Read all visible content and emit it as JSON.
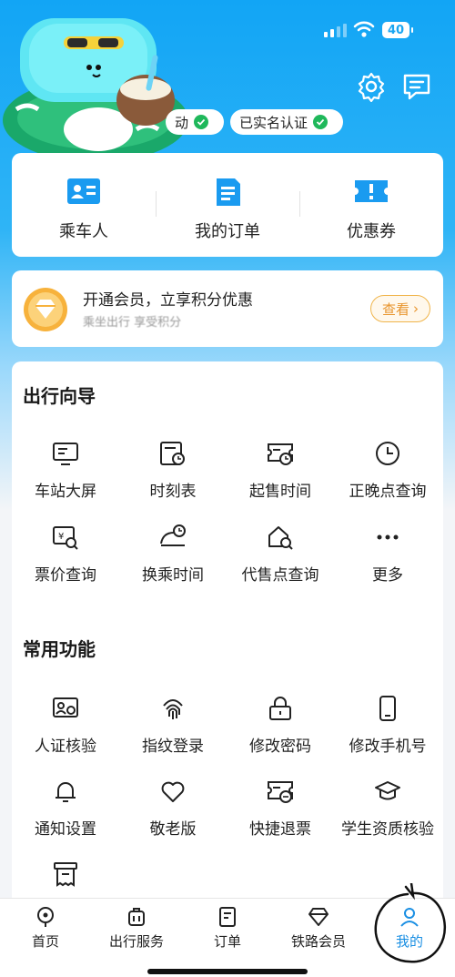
{
  "status_bar": {
    "battery": "40"
  },
  "verification": {
    "badge_partial": "动",
    "badge_real_name": "已实名认证"
  },
  "quick_actions": [
    {
      "label": "乘车人",
      "icon": "passenger-card-icon"
    },
    {
      "label": "我的订单",
      "icon": "order-document-icon"
    },
    {
      "label": "优惠券",
      "icon": "coupon-icon"
    }
  ],
  "member_banner": {
    "title": "开通会员，立享积分优惠",
    "subtitle": "乘坐出行 享受积分",
    "button": "查看"
  },
  "travel_guide": {
    "title": "出行向导",
    "items": [
      {
        "label": "车站大屏",
        "icon": "station-screen-icon"
      },
      {
        "label": "时刻表",
        "icon": "timetable-icon"
      },
      {
        "label": "起售时间",
        "icon": "sale-time-icon"
      },
      {
        "label": "正晚点查询",
        "icon": "clock-icon"
      },
      {
        "label": "票价查询",
        "icon": "fare-search-icon"
      },
      {
        "label": "换乘时间",
        "icon": "transfer-time-icon"
      },
      {
        "label": "代售点查询",
        "icon": "agency-search-icon"
      },
      {
        "label": "更多",
        "icon": "more-icon"
      }
    ]
  },
  "common_functions": {
    "title": "常用功能",
    "items": [
      {
        "label": "人证核验",
        "icon": "id-verify-icon"
      },
      {
        "label": "指纹登录",
        "icon": "fingerprint-icon"
      },
      {
        "label": "修改密码",
        "icon": "lock-icon"
      },
      {
        "label": "修改手机号",
        "icon": "phone-icon"
      },
      {
        "label": "通知设置",
        "icon": "bell-icon"
      },
      {
        "label": "敬老版",
        "icon": "heart-icon"
      },
      {
        "label": "快捷退票",
        "icon": "refund-ticket-icon"
      },
      {
        "label": "学生资质核验",
        "icon": "graduation-cap-icon"
      },
      {
        "label": "",
        "icon": "invoice-icon"
      }
    ]
  },
  "bottom_nav": [
    {
      "label": "首页",
      "icon": "home-icon"
    },
    {
      "label": "出行服务",
      "icon": "luggage-icon"
    },
    {
      "label": "订单",
      "icon": "order-icon"
    },
    {
      "label": "铁路会员",
      "icon": "diamond-icon"
    },
    {
      "label": "我的",
      "icon": "user-icon",
      "active": true
    }
  ],
  "colors": {
    "brand_blue": "#1aa6f2",
    "active_tab": "#1a8fe3",
    "member_gold": "#e8952d",
    "verified_green": "#1fb85b"
  }
}
